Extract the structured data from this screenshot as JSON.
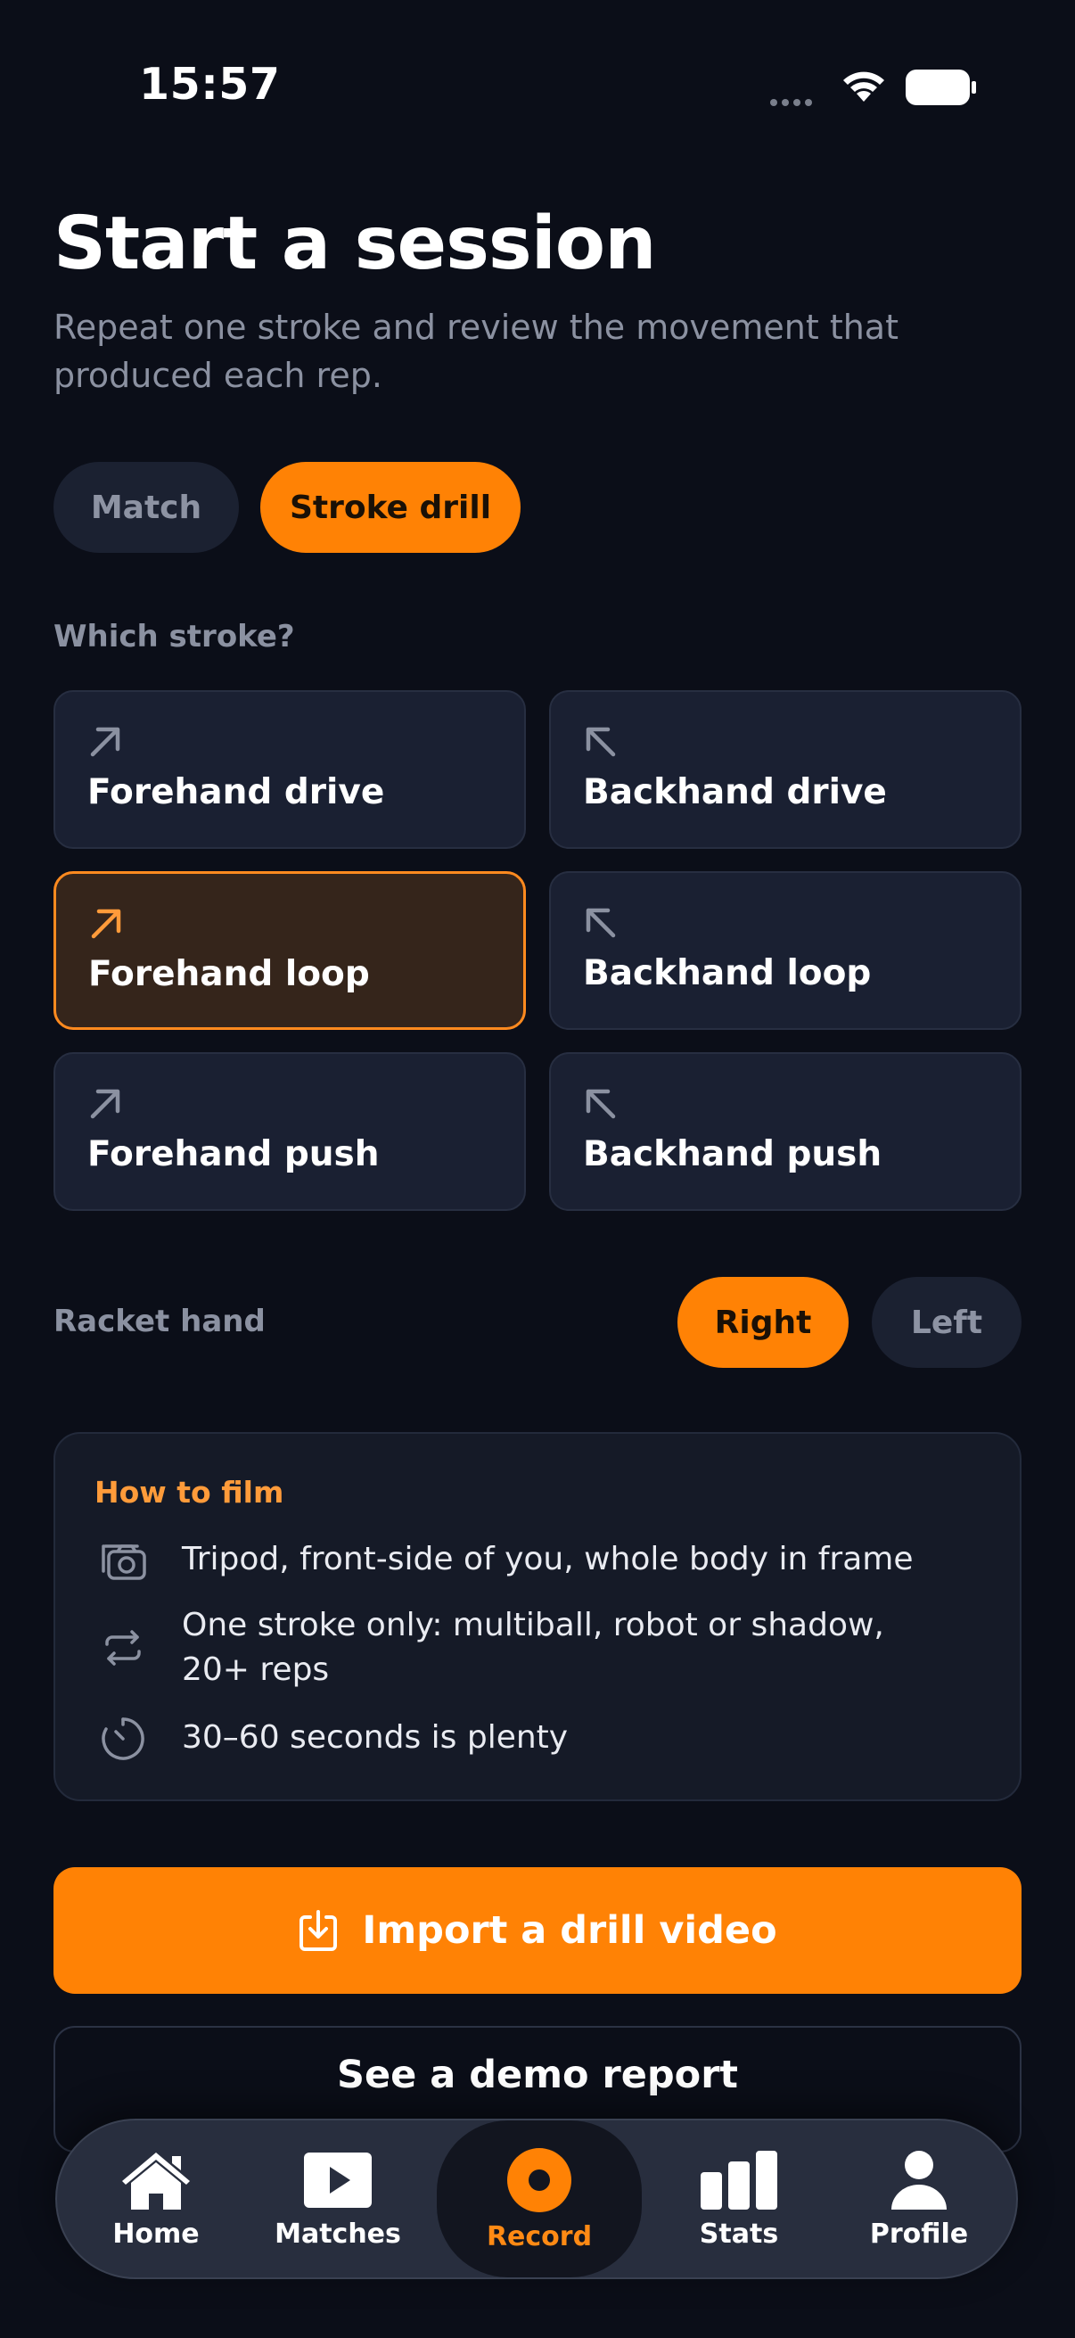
{
  "status_bar": {
    "time": "15:57"
  },
  "header": {
    "title": "Start a session",
    "subtitle": "Repeat one stroke and review the movement that produced each rep."
  },
  "mode_toggle": {
    "options": [
      "Match",
      "Stroke drill"
    ],
    "selected": "Stroke drill"
  },
  "stroke_section": {
    "label": "Which stroke?",
    "strokes": [
      {
        "label": "Forehand drive",
        "icon": "arrow-up-right-icon",
        "selected": false
      },
      {
        "label": "Backhand drive",
        "icon": "arrow-up-left-icon",
        "selected": false
      },
      {
        "label": "Forehand loop",
        "icon": "arrow-up-right-icon",
        "selected": true
      },
      {
        "label": "Backhand loop",
        "icon": "arrow-up-left-icon",
        "selected": false
      },
      {
        "label": "Forehand push",
        "icon": "arrow-up-right-icon",
        "selected": false
      },
      {
        "label": "Backhand push",
        "icon": "arrow-up-left-icon",
        "selected": false
      }
    ]
  },
  "racket_hand": {
    "label": "Racket hand",
    "options": [
      "Right",
      "Left"
    ],
    "selected": "Right"
  },
  "how_to_film": {
    "title": "How to film",
    "tips": [
      {
        "icon": "camera-switch-icon",
        "text": "Tripod, front-side of you, whole body in frame"
      },
      {
        "icon": "repeat-icon",
        "text": "One stroke only: multiball, robot or shadow, 20+ reps"
      },
      {
        "icon": "timer-icon",
        "text": "30–60 seconds is plenty"
      }
    ]
  },
  "actions": {
    "import_label": "Import a drill video",
    "demo_label": "See a demo report"
  },
  "tab_bar": {
    "tabs": [
      {
        "label": "Home",
        "icon": "home-icon"
      },
      {
        "label": "Matches",
        "icon": "play-icon"
      },
      {
        "label": "Record",
        "icon": "record-icon"
      },
      {
        "label": "Stats",
        "icon": "stats-icon"
      },
      {
        "label": "Profile",
        "icon": "profile-icon"
      }
    ],
    "active": "Record"
  },
  "colors": {
    "accent": "#ff8205",
    "background": "#0b0e18",
    "card": "#1a2032",
    "selected_card": "#35251b"
  }
}
